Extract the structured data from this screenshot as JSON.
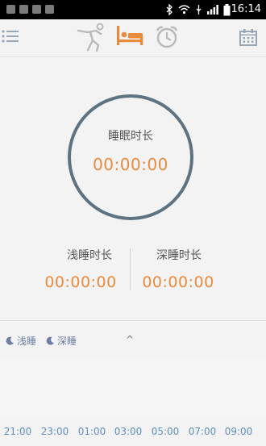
{
  "status_bar": {
    "time": "16:14"
  },
  "toolbar": {
    "icons": [
      "menu-icon",
      "runner-icon",
      "bed-icon",
      "alarm-icon",
      "calendar-icon"
    ],
    "active_color": "#e98a3c",
    "inactive_color": "#b9b9b9"
  },
  "summary": {
    "total_label": "睡眠时长",
    "total_value": "00:00:00",
    "light_label": "浅睡时长",
    "light_value": "00:00:00",
    "deep_label": "深睡时长",
    "deep_value": "00:00:00"
  },
  "legend": {
    "light": "浅睡",
    "deep": "深睡",
    "toggle": "^"
  },
  "timeline": {
    "ticks": [
      "21:00",
      "23:00",
      "01:00",
      "03:00",
      "05:00",
      "07:00",
      "09:00"
    ]
  }
}
